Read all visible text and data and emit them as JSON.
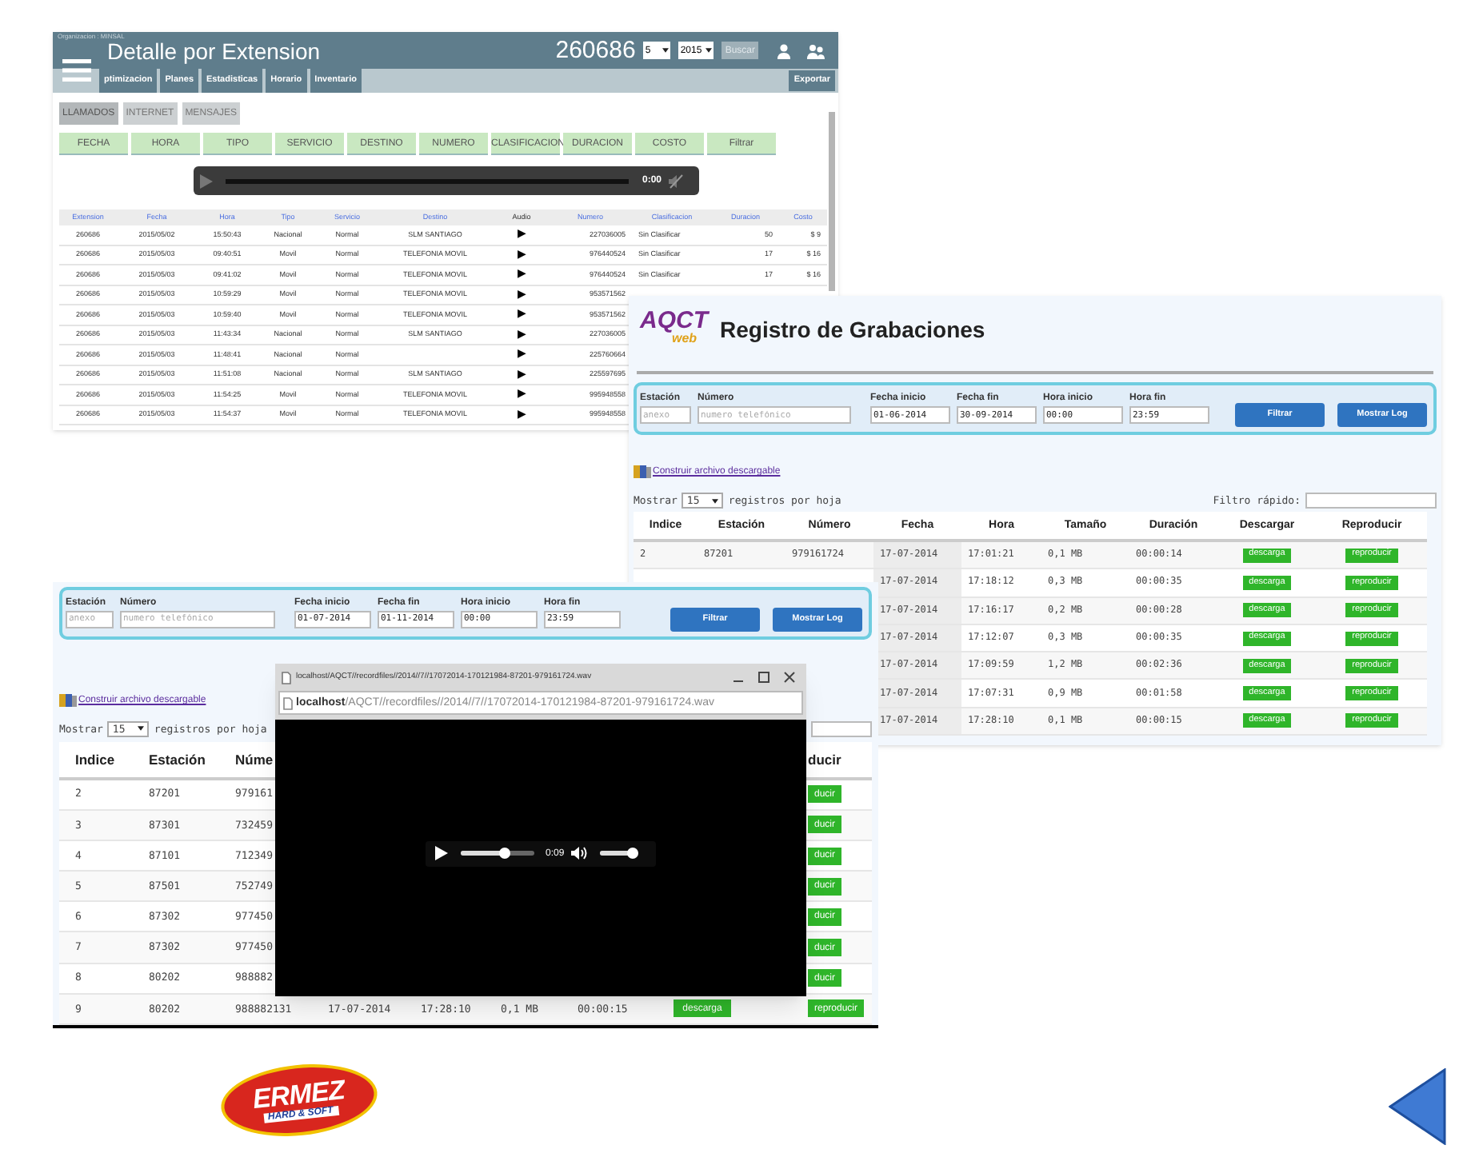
{
  "detalle": {
    "org": "Organizacion : MINSAL",
    "title": "Detalle por Extension",
    "extension": "260686",
    "month": "5",
    "year": "2015",
    "search_button": "Buscar",
    "nav": [
      "ptimizacion",
      "Planes",
      "Estadisticas",
      "Horario",
      "Inventario"
    ],
    "export_button": "Exportar",
    "tabs": [
      {
        "label": "LLAMADOS",
        "selected": true
      },
      {
        "label": "INTERNET",
        "selected": false
      },
      {
        "label": "MENSAJES",
        "selected": false
      }
    ],
    "sort_buttons": [
      "FECHA",
      "HORA",
      "TIPO",
      "SERVICIO",
      "DESTINO",
      "NUMERO",
      "CLASIFICACION",
      "DURACION",
      "COSTO",
      "Filtrar"
    ],
    "player": {
      "time": "0:00",
      "level": 0,
      "muted": true
    },
    "columns": [
      "Extension",
      "Fecha",
      "Hora",
      "Tipo",
      "Servicio",
      "Destino",
      "Audio",
      "Numero",
      "Clasificacion",
      "Duracion",
      "Costo"
    ],
    "rows": [
      {
        "extension": "260686",
        "fecha": "2015/05/02",
        "hora": "15:50:43",
        "tipo": "Nacional",
        "servicio": "Normal",
        "destino": "SLM SANTIAGO",
        "audio": "▶",
        "numero": "227036005",
        "clasificacion": "Sin Clasificar",
        "duracion": "50",
        "costo": "$ 9"
      },
      {
        "extension": "260686",
        "fecha": "2015/05/03",
        "hora": "09:40:51",
        "tipo": "Movil",
        "servicio": "Normal",
        "destino": "TELEFONIA MOVIL",
        "audio": "▶",
        "numero": "976440524",
        "clasificacion": "Sin Clasificar",
        "duracion": "17",
        "costo": "$ 16"
      },
      {
        "extension": "260686",
        "fecha": "2015/05/03",
        "hora": "09:41:02",
        "tipo": "Movil",
        "servicio": "Normal",
        "destino": "TELEFONIA MOVIL",
        "audio": "▶",
        "numero": "976440524",
        "clasificacion": "Sin Clasificar",
        "duracion": "17",
        "costo": "$ 16"
      },
      {
        "extension": "260686",
        "fecha": "2015/05/03",
        "hora": "10:59:29",
        "tipo": "Movil",
        "servicio": "Normal",
        "destino": "TELEFONIA MOVIL",
        "audio": "▶",
        "numero": "953571562"
      },
      {
        "extension": "260686",
        "fecha": "2015/05/03",
        "hora": "10:59:40",
        "tipo": "Movil",
        "servicio": "Normal",
        "destino": "TELEFONIA MOVIL",
        "audio": "▶",
        "numero": "953571562"
      },
      {
        "extension": "260686",
        "fecha": "2015/05/03",
        "hora": "11:43:34",
        "tipo": "Nacional",
        "servicio": "Normal",
        "destino": "SLM SANTIAGO",
        "audio": "▶",
        "numero": "227036005"
      },
      {
        "extension": "260686",
        "fecha": "2015/05/03",
        "hora": "11:48:41",
        "tipo": "Nacional",
        "servicio": "Normal",
        "audio": "▶",
        "numero": "225760664"
      },
      {
        "extension": "260686",
        "fecha": "2015/05/03",
        "hora": "11:51:08",
        "tipo": "Nacional",
        "servicio": "Normal",
        "destino": "SLM SANTIAGO",
        "audio": "▶",
        "numero": "225597695"
      },
      {
        "extension": "260686",
        "fecha": "2015/05/03",
        "hora": "11:54:25",
        "tipo": "Movil",
        "servicio": "Normal",
        "destino": "TELEFONIA MOVIL",
        "audio": "▶",
        "numero": "995948558"
      },
      {
        "extension": "260686",
        "fecha": "2015/05/03",
        "hora": "11:54:37",
        "tipo": "Movil",
        "servicio": "Normal",
        "destino": "TELEFONIA MOVIL",
        "audio": "▶",
        "numero": "995948558"
      }
    ]
  },
  "grabaciones": {
    "logo": {
      "main": "AQCT",
      "sub": "web"
    },
    "title": "Registro de Grabaciones",
    "fields": [
      {
        "label": "Estación",
        "placeholder": "anexo"
      },
      {
        "label": "Número",
        "placeholder": "numero telefónico"
      },
      {
        "label": "Fecha inicio",
        "value": "01-06-2014"
      },
      {
        "label": "Fecha fin",
        "value": "30-09-2014"
      },
      {
        "label": "Hora inicio",
        "value": "00:00"
      },
      {
        "label": "Hora fin",
        "value": "23:59"
      }
    ],
    "buttons": [
      "Filtrar",
      "Mostrar Log"
    ],
    "download_link": "Construir archivo descargable",
    "show": {
      "before": "Mostrar",
      "value": "15",
      "after": "registros por hoja"
    },
    "quick_filter": "Filtro rápido:",
    "columns": [
      "Indice",
      "Estación",
      "Número",
      "Fecha",
      "Hora",
      "Tamaño",
      "Duración",
      "Descargar",
      "Reproducir"
    ],
    "rows": [
      {
        "indice": "2",
        "estacion": "87201",
        "numero": "979161724",
        "fecha": "17-07-2014",
        "hora": "17:01:21",
        "tamano": "0,1 MB",
        "duracion": "00:00:14",
        "descargar": "descarga",
        "reproducir": "reproducir"
      },
      {
        "fecha": "17-07-2014",
        "hora": "17:18:12",
        "tamano": "0,3 MB",
        "duracion": "00:00:35",
        "descargar": "descarga",
        "reproducir": "reproducir"
      },
      {
        "fecha": "17-07-2014",
        "hora": "17:16:17",
        "tamano": "0,2 MB",
        "duracion": "00:00:28",
        "descargar": "descarga",
        "reproducir": "reproducir"
      },
      {
        "fecha": "17-07-2014",
        "hora": "17:12:07",
        "tamano": "0,3 MB",
        "duracion": "00:00:35",
        "descargar": "descarga",
        "reproducir": "reproducir"
      },
      {
        "fecha": "17-07-2014",
        "hora": "17:09:59",
        "tamano": "1,2 MB",
        "duracion": "00:02:36",
        "descargar": "descarga",
        "reproducir": "reproducir"
      },
      {
        "fecha": "17-07-2014",
        "hora": "17:07:31",
        "tamano": "0,9 MB",
        "duracion": "00:01:58",
        "descargar": "descarga",
        "reproducir": "reproducir"
      },
      {
        "fecha": "17-07-2014",
        "hora": "17:28:10",
        "tamano": "0,1 MB",
        "duracion": "00:00:15",
        "descargar": "descarga",
        "reproducir": "reproducir"
      }
    ]
  },
  "grabaciones_2": {
    "fields": [
      {
        "label": "Estación",
        "placeholder": "anexo"
      },
      {
        "label": "Número",
        "placeholder": "numero telefónico"
      },
      {
        "label": "Fecha inicio",
        "value": "01-07-2014"
      },
      {
        "label": "Fecha fin",
        "value": "01-11-2014"
      },
      {
        "label": "Hora inicio",
        "value": "00:00"
      },
      {
        "label": "Hora fin",
        "value": "23:59"
      }
    ],
    "buttons": [
      "Filtrar",
      "Mostrar Log"
    ],
    "download_link": "Construir archivo descargable",
    "show": {
      "before": "Mostrar",
      "value": "15",
      "after": "registros por hoja"
    },
    "columns": [
      "Indice",
      "Estación",
      "Núme",
      "ducir"
    ],
    "rows": [
      {
        "indice": "2",
        "estacion": "87201",
        "numero": "979161",
        "reproducir": "ducir"
      },
      {
        "indice": "3",
        "estacion": "87301",
        "numero": "732459",
        "reproducir": "ducir"
      },
      {
        "indice": "4",
        "estacion": "87101",
        "numero": "712349",
        "reproducir": "ducir"
      },
      {
        "indice": "5",
        "estacion": "87501",
        "numero": "752749",
        "reproducir": "ducir"
      },
      {
        "indice": "6",
        "estacion": "87302",
        "numero": "977450",
        "reproducir": "ducir"
      },
      {
        "indice": "7",
        "estacion": "87302",
        "numero": "977450",
        "reproducir": "ducir"
      },
      {
        "indice": "8",
        "estacion": "80202",
        "numero": "988882",
        "reproducir": "ducir"
      },
      {
        "indice": "9",
        "estacion": "80202",
        "numero": "988882131",
        "fecha": "17-07-2014",
        "hora": "17:28:10",
        "tamano": "0,1 MB",
        "duracion": "00:00:15",
        "descargar": "descarga",
        "reproducir": "reproducir"
      }
    ]
  },
  "popup": {
    "title": "localhost/AQCT//recordfiles//2014//7//17072014-170121984-87201-979161724.wav",
    "address": {
      "host": "localhost",
      "path": "/AQCT//recordfiles//2014//7//17072014-170121984-87201-979161724.wav"
    },
    "player": {
      "time": "0:09",
      "level": 0.6,
      "volume": {
        "level": 0.85
      },
      "muted": false
    }
  },
  "company_logo": {
    "name": "ERMEZ",
    "tagline": "HARD & SOFT"
  }
}
